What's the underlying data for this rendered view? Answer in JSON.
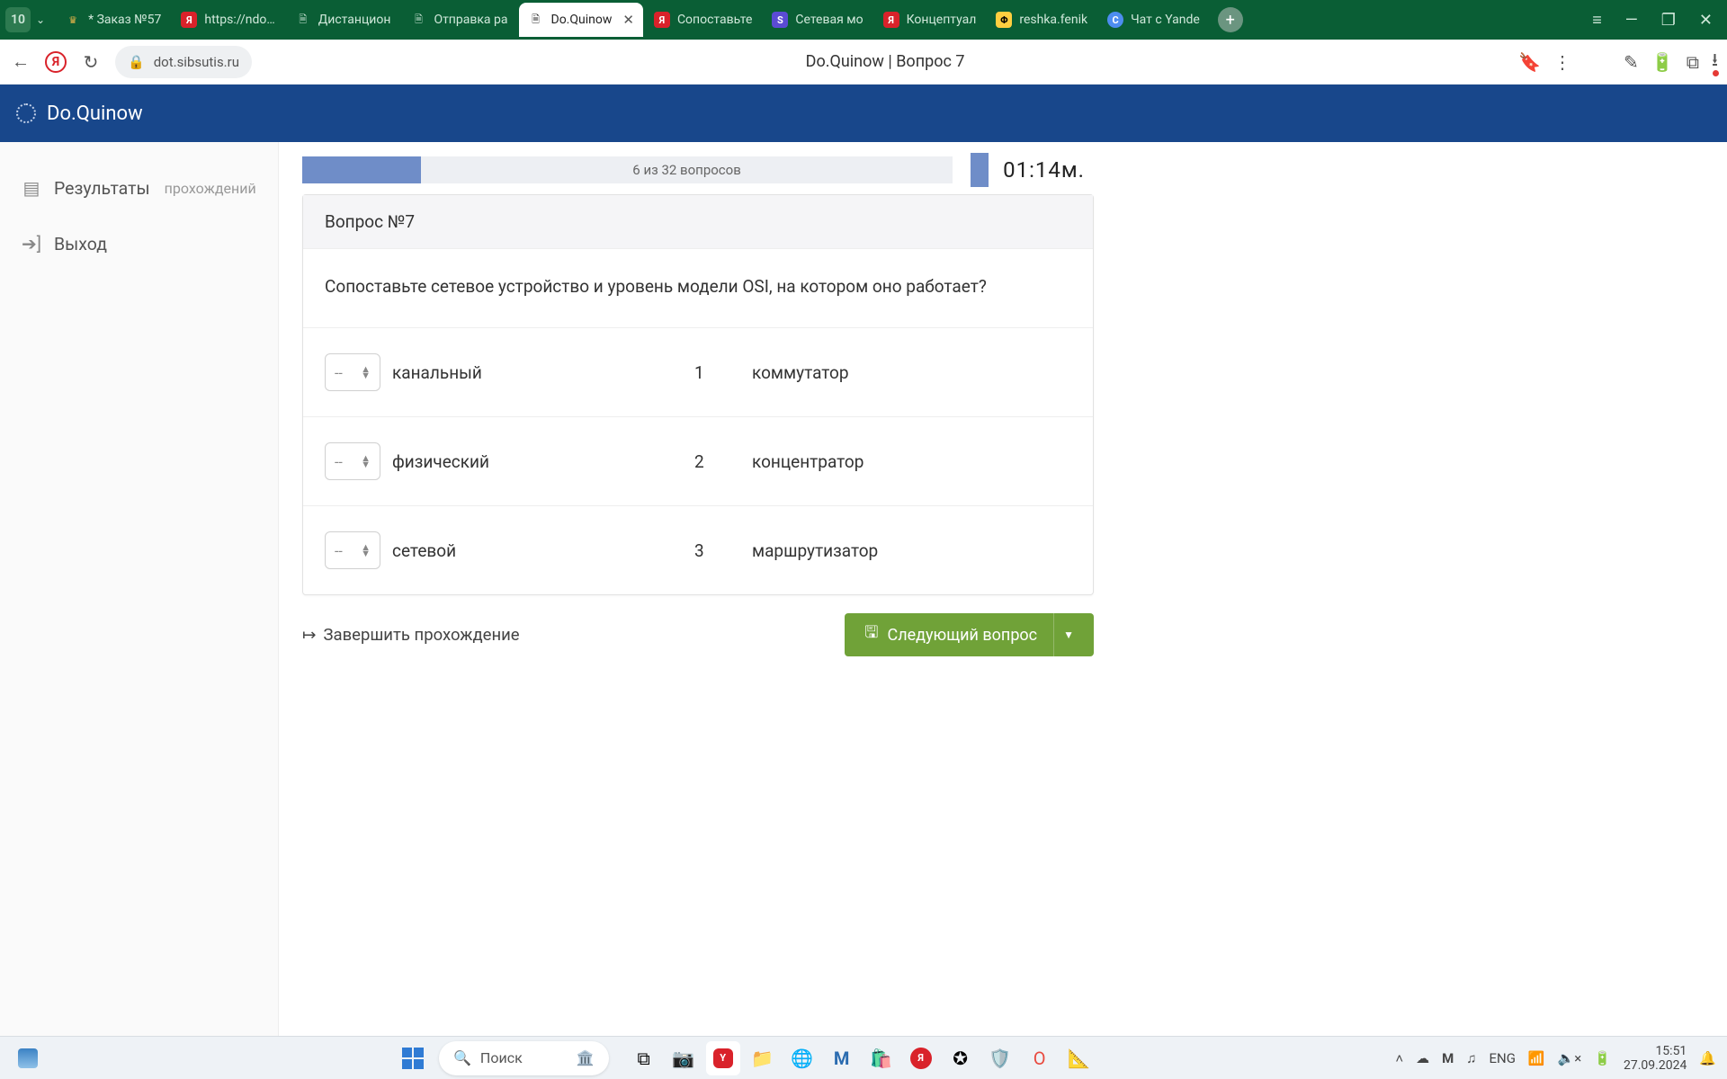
{
  "browser": {
    "tab_count": "10",
    "tabs": [
      {
        "label": "* Заказ №57",
        "fav": "crown"
      },
      {
        "label": "https://ndo…",
        "fav": "ya"
      },
      {
        "label": "Дистанцион",
        "fav": "doc"
      },
      {
        "label": "Отправка ра",
        "fav": "doc"
      },
      {
        "label": "Do.Quinow",
        "fav": "doc",
        "active": true
      },
      {
        "label": "Сопоставьте",
        "fav": "ya"
      },
      {
        "label": "Сетевая мо",
        "fav": "s"
      },
      {
        "label": "Концептуал",
        "fav": "ya"
      },
      {
        "label": "reshka.fenik",
        "fav": "y"
      },
      {
        "label": "Чат с Yande",
        "fav": "c"
      }
    ],
    "url": "dot.sibsutis.ru",
    "page_title": "Do.Quinow | Вопрос 7"
  },
  "app": {
    "brand": "Do.Quinow"
  },
  "sidebar": {
    "results_main": "Результаты",
    "results_sub": "прохождений",
    "logout": "Выход"
  },
  "quiz": {
    "progress_text": "6 из 32 вопросов",
    "timer": "01:14м.",
    "question_header": "Вопрос №7",
    "question_text": "Сопоставьте сетевое устройство и уровень модели OSI, на котором оно работает?",
    "select_placeholder": "--",
    "left": [
      "канальный",
      "физический",
      "сетевой"
    ],
    "right_num": [
      "1",
      "2",
      "3"
    ],
    "right": [
      "коммутатор",
      "концентратор",
      "маршрутизатор"
    ],
    "finish": "Завершить прохождение",
    "next": "Следующий вопрос"
  },
  "taskbar": {
    "search_placeholder": "Поиск",
    "lang": "ENG",
    "time": "15:51",
    "date": "27.09.2024"
  }
}
